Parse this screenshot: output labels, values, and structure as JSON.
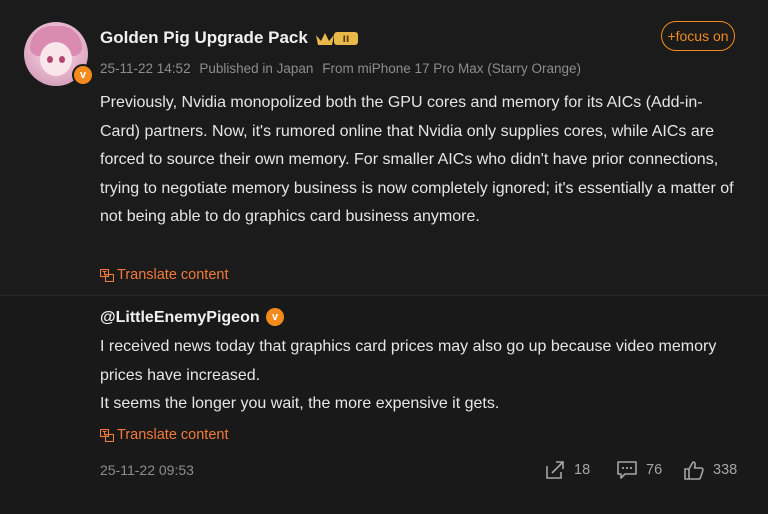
{
  "post": {
    "username": "Golden Pig Upgrade Pack",
    "level_badge": "II",
    "meta": {
      "timestamp": "25-11-22 14:52",
      "location": "Published in Japan",
      "device": "From miPhone 17 Pro Max (Starry Orange)"
    },
    "follow_label": "+focus on",
    "body": "Previously, Nvidia monopolized both the GPU cores and memory for its AICs (Add-in-Card) partners. Now, it's rumored online that Nvidia only supplies cores, while AICs are forced to source their own memory. For smaller AICs who didn't have prior connections, trying to negotiate memory business is now completely ignored; it's essentially a matter of not being able to do graphics card business anymore.",
    "translate_label": "Translate content"
  },
  "reply": {
    "username": "@LittleEnemyPigeon",
    "line1": "I received news today that graphics card prices may also go up because video memory prices have increased.",
    "line2": "It seems the longer you wait, the more expensive it gets.",
    "translate_label": "Translate content",
    "timestamp": "25-11-22 09:53",
    "share_count": "18",
    "comment_count": "76",
    "like_count": "338"
  },
  "colors": {
    "accent": "#f28a1c",
    "translate": "#f07a3c",
    "background": "#1b1b1b",
    "text": "#e6e6e6",
    "muted": "#8d8d8d"
  },
  "icons": [
    "verified-icon",
    "crown-icon",
    "translate-icon",
    "share-icon",
    "comment-icon",
    "like-icon"
  ]
}
